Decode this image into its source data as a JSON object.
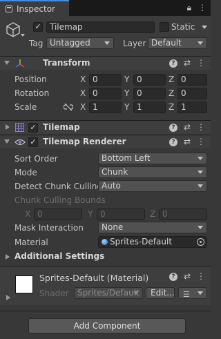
{
  "tab": {
    "title": "Inspector"
  },
  "object": {
    "name": "Tilemap",
    "static_label": "Static",
    "tag_label": "Tag",
    "tag_value": "Untagged",
    "layer_label": "Layer",
    "layer_value": "Default"
  },
  "transform": {
    "title": "Transform",
    "rows": [
      {
        "label": "Position",
        "x": "0",
        "y": "0",
        "z": "0"
      },
      {
        "label": "Rotation",
        "x": "0",
        "y": "0",
        "z": "0"
      },
      {
        "label": "Scale",
        "x": "1",
        "y": "1",
        "z": "1"
      }
    ],
    "axis_x": "X",
    "axis_y": "Y",
    "axis_z": "Z"
  },
  "tilemap": {
    "title": "Tilemap"
  },
  "renderer": {
    "title": "Tilemap Renderer",
    "sort_order_label": "Sort Order",
    "sort_order_value": "Bottom Left",
    "mode_label": "Mode",
    "mode_value": "Chunk",
    "culling_label": "Detect Chunk Culling",
    "culling_value": "Auto",
    "bounds_label": "Chunk Culling Bounds",
    "bounds_x": "0",
    "bounds_y": "0",
    "bounds_z": "0",
    "mask_label": "Mask Interaction",
    "mask_value": "None",
    "material_label": "Material",
    "material_value": "Sprites-Default",
    "additional_label": "Additional Settings"
  },
  "material": {
    "title": "Sprites-Default (Material)",
    "shader_label": "Shader",
    "shader_value": "Sprites/Default",
    "edit_label": "Edit..."
  },
  "add_component": "Add Component"
}
